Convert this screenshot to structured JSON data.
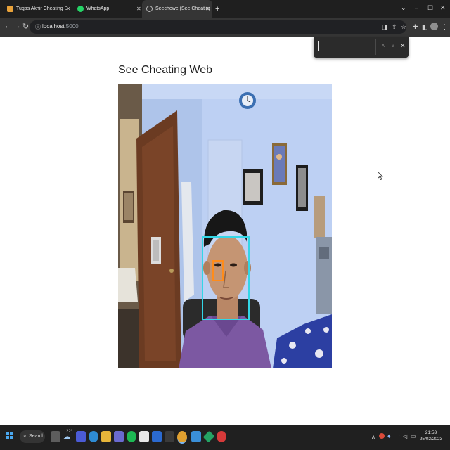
{
  "browser": {
    "tabs": [
      {
        "title": "Tugas Akhir Cheating Detection",
        "active": false
      },
      {
        "title": "WhatsApp",
        "active": false
      },
      {
        "title": "Seechewe (See Cheating Web)",
        "active": true
      }
    ],
    "new_tab_label": "+",
    "url_host": "localhost",
    "url_port": ":5000"
  },
  "page": {
    "heading": "See Cheating Web"
  },
  "taskbar": {
    "search_label": "Search",
    "weather_temp": "22°",
    "time": "21:53",
    "date": "25/02/2023"
  },
  "colors": {
    "face_box": "#33d6e6",
    "eye_box": "#ff8c1a",
    "tab_bg": "#1f1f1f",
    "toolbar_bg": "#353535"
  }
}
